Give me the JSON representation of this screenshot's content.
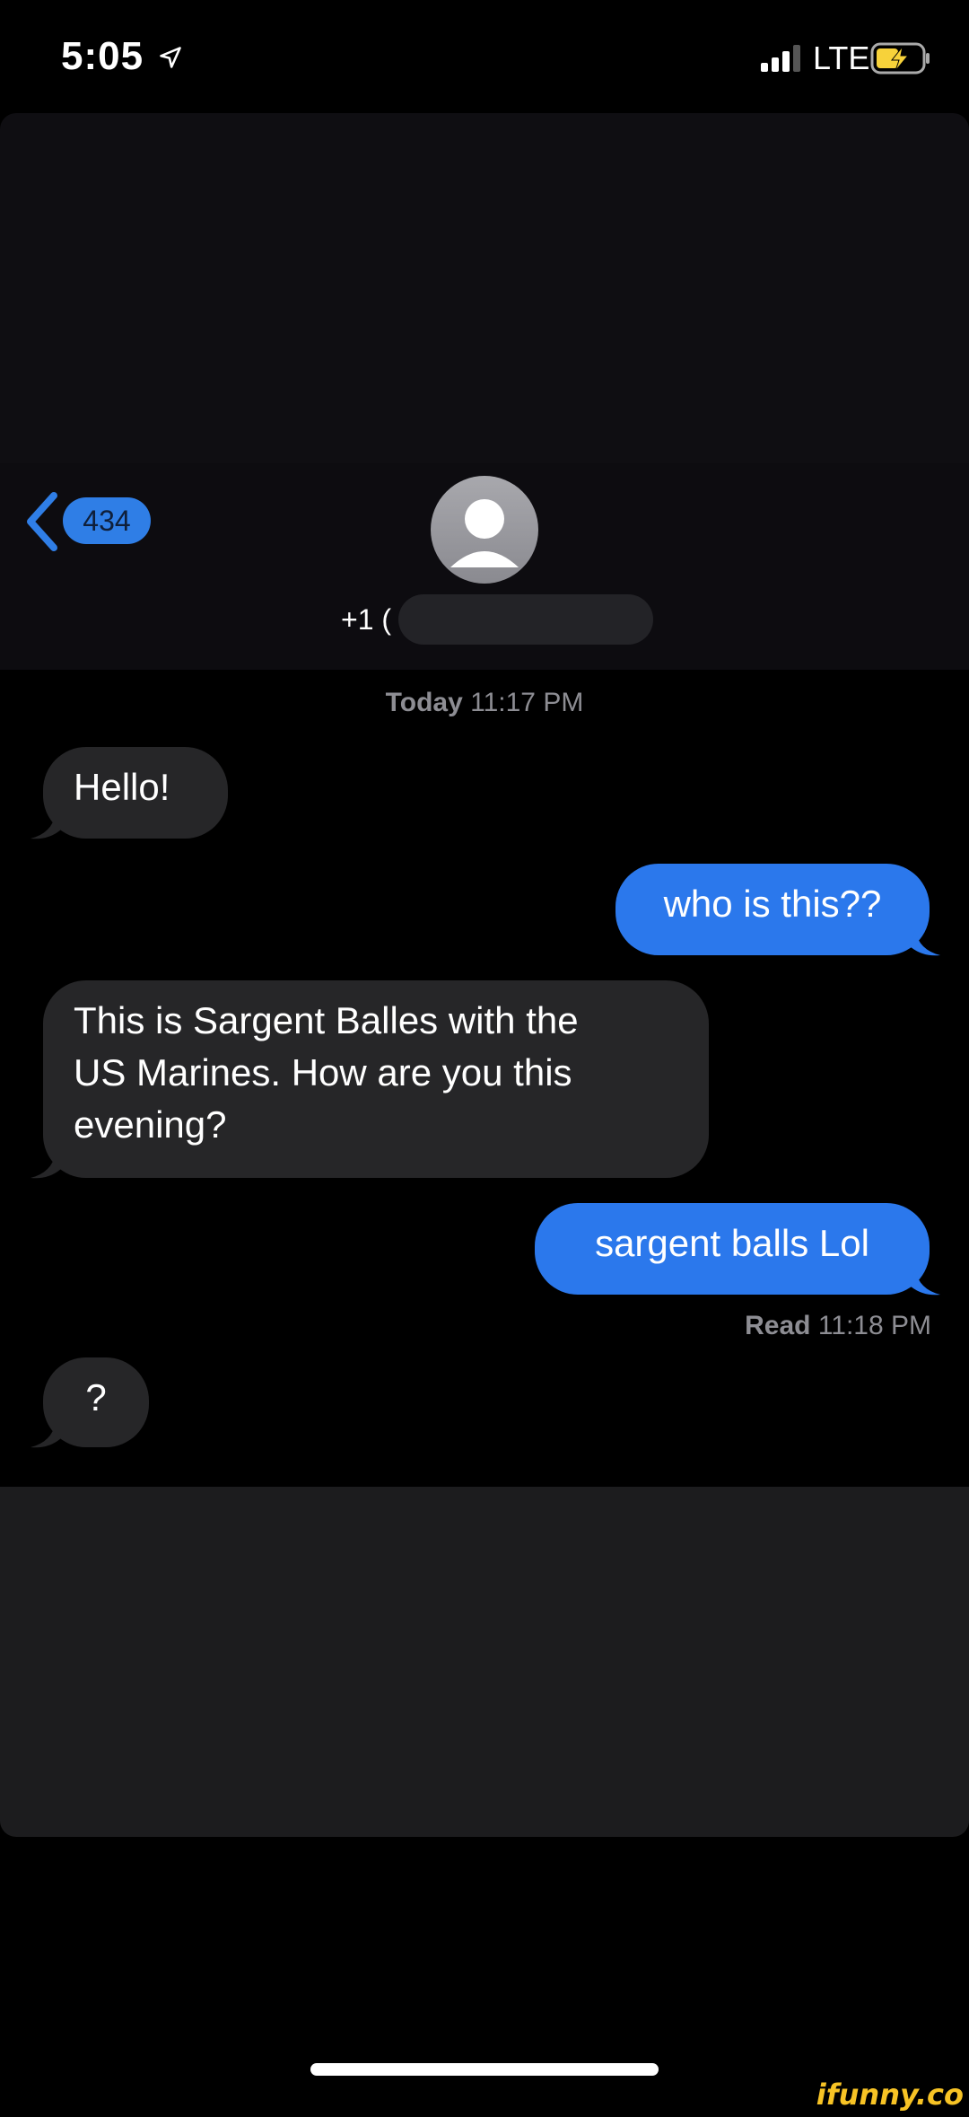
{
  "status_bar": {
    "time": "5:05",
    "network": "LTE"
  },
  "header": {
    "unread_count": "434",
    "contact_prefix": "+1 ("
  },
  "conversation": {
    "timestamp_day": "Today",
    "timestamp_time": "11:17 PM",
    "messages": [
      {
        "direction": "incoming",
        "text": "Hello!"
      },
      {
        "direction": "outgoing",
        "text": "who is this??"
      },
      {
        "direction": "incoming",
        "lines": [
          "This is Sargent Balles with the",
          "US Marines. How are you this",
          "evening?"
        ]
      },
      {
        "direction": "outgoing",
        "text": "sargent balls Lol"
      },
      {
        "direction": "incoming",
        "text": "?"
      }
    ],
    "read_label": "Read",
    "read_time": "11:18 PM"
  },
  "colors": {
    "outgoing_bubble": "#2b78ec",
    "incoming_bubble": "#262628",
    "accent": "#2f7ee6"
  },
  "watermark": "ifunny.co"
}
